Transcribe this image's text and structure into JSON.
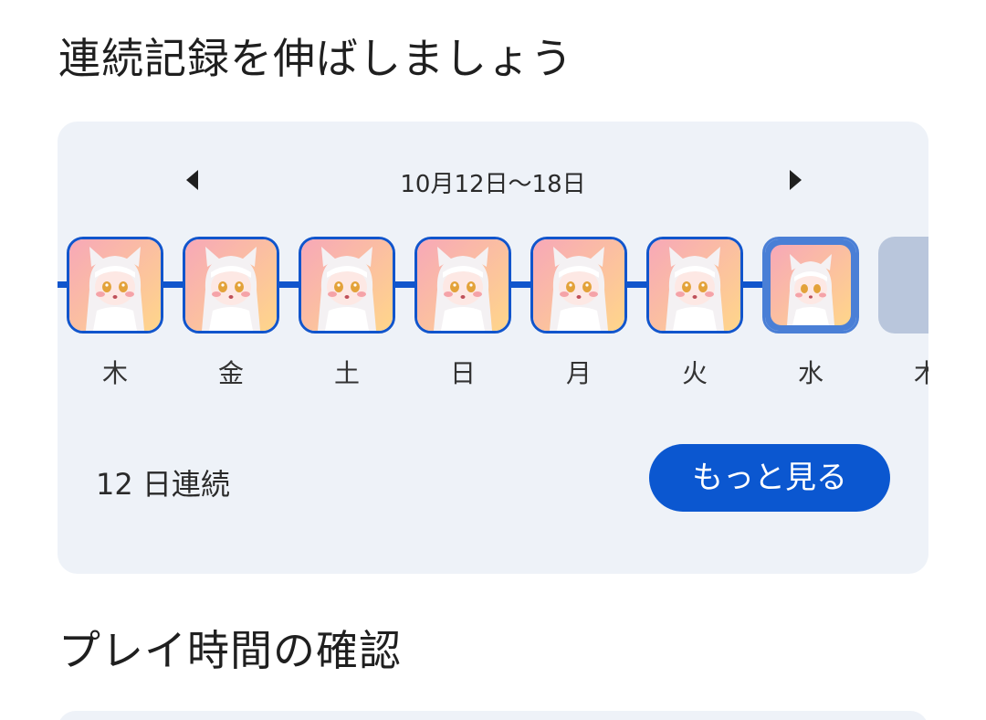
{
  "sections": {
    "streak_title": "連続記録を伸ばしましょう",
    "playtime_title": "プレイ時間の確認"
  },
  "streak_card": {
    "week_range": "10月12日〜18日",
    "prev_icon": "triangle-left-icon",
    "next_icon": "triangle-right-icon",
    "days": [
      {
        "label": "木",
        "status": "completed"
      },
      {
        "label": "金",
        "status": "completed"
      },
      {
        "label": "土",
        "status": "completed"
      },
      {
        "label": "日",
        "status": "completed"
      },
      {
        "label": "月",
        "status": "completed"
      },
      {
        "label": "火",
        "status": "completed"
      },
      {
        "label": "水",
        "status": "today"
      },
      {
        "label": "木",
        "status": "future"
      }
    ],
    "streak_text": "12 日連続",
    "more_button": "もっと見る"
  },
  "colors": {
    "accent": "#0b57d0",
    "timeline": "#1155cc",
    "card_bg": "#eef2f8",
    "future_tile": "#b9c6dc"
  }
}
